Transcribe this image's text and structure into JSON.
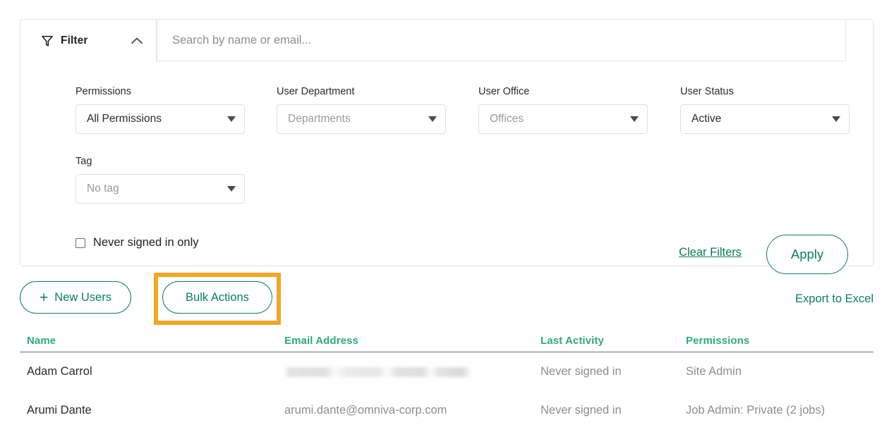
{
  "filter_panel": {
    "title": "Filter",
    "funnel_icon": "funnel-icon",
    "collapse_icon": "chevron-up-icon",
    "search": {
      "placeholder": "Search by name or email...",
      "value": ""
    },
    "fields": [
      {
        "label": "Permissions",
        "value": "All Permissions",
        "is_placeholder": false
      },
      {
        "label": "User Department",
        "value": "Departments",
        "is_placeholder": true
      },
      {
        "label": "User Office",
        "value": "Offices",
        "is_placeholder": true
      },
      {
        "label": "User Status",
        "value": "Active",
        "is_placeholder": false
      },
      {
        "label": "Tag",
        "value": "No tag",
        "is_placeholder": true
      }
    ],
    "never_signed_in": {
      "label": "Never signed in only",
      "checked": false
    },
    "clear_filters_label": "Clear Filters",
    "apply_label": "Apply"
  },
  "actions": {
    "new_users_label": "New Users",
    "new_users_icon": "plus-icon",
    "bulk_actions_label": "Bulk Actions",
    "export_label": "Export to Excel",
    "highlight_color": "#f5a623"
  },
  "table": {
    "columns": [
      "Name",
      "Email Address",
      "Last Activity",
      "Permissions"
    ],
    "rows": [
      {
        "name": "Adam Carrol",
        "email": "",
        "email_redacted": true,
        "last_activity": "Never signed in",
        "permissions": "Site Admin"
      },
      {
        "name": "Arumi Dante",
        "email": "arumi.dante@omniva-corp.com",
        "email_redacted": false,
        "last_activity": "Never signed in",
        "permissions": "Job Admin: Private (2 jobs)"
      }
    ]
  },
  "theme": {
    "accent_green": "#0a8159",
    "header_green": "#2eab79",
    "highlight_orange": "#f5a623"
  }
}
